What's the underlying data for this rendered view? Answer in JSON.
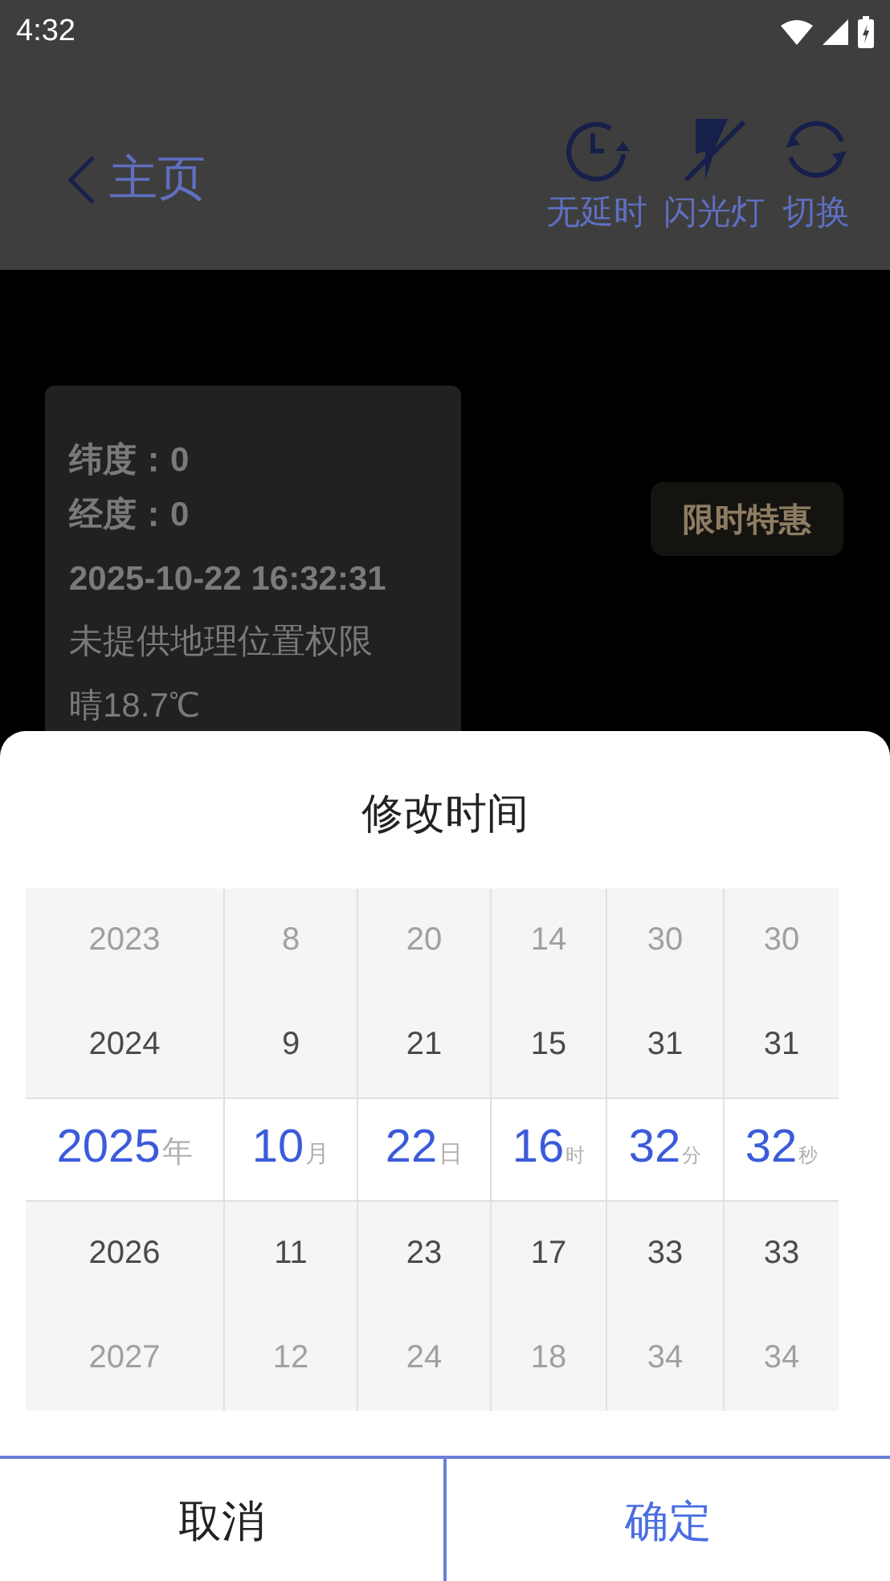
{
  "status_bar": {
    "time": "4:32"
  },
  "header": {
    "back_label": "主页",
    "actions": [
      {
        "kind": "timer",
        "label": "无延时"
      },
      {
        "kind": "flash-off",
        "label": "闪光灯"
      },
      {
        "kind": "switch",
        "label": "切换"
      }
    ]
  },
  "info_card": {
    "lines": [
      "纬度：0",
      "经度：0",
      "2025-10-22  16:32:31",
      "未提供地理位置权限",
      "晴18.7℃"
    ]
  },
  "promo_badge": "限时特惠",
  "dialog": {
    "title": "修改时间",
    "columns": [
      {
        "unit": "年",
        "items": [
          {
            "label": "2023",
            "selected": false
          },
          {
            "label": "2024",
            "selected": false
          },
          {
            "label": "2025",
            "selected": true
          },
          {
            "label": "2026",
            "selected": false
          },
          {
            "label": "2027",
            "selected": false
          }
        ]
      },
      {
        "unit": "月",
        "items": [
          {
            "label": "8",
            "selected": false
          },
          {
            "label": "9",
            "selected": false
          },
          {
            "label": "10",
            "selected": true
          },
          {
            "label": "11",
            "selected": false
          },
          {
            "label": "12",
            "selected": false
          }
        ]
      },
      {
        "unit": "日",
        "items": [
          {
            "label": "20",
            "selected": false
          },
          {
            "label": "21",
            "selected": false
          },
          {
            "label": "22",
            "selected": true
          },
          {
            "label": "23",
            "selected": false
          },
          {
            "label": "24",
            "selected": false
          }
        ]
      },
      {
        "unit": "时",
        "items": [
          {
            "label": "14",
            "selected": false
          },
          {
            "label": "15",
            "selected": false
          },
          {
            "label": "16",
            "selected": true
          },
          {
            "label": "17",
            "selected": false
          },
          {
            "label": "18",
            "selected": false
          }
        ]
      },
      {
        "unit": "分",
        "items": [
          {
            "label": "30",
            "selected": false
          },
          {
            "label": "31",
            "selected": false
          },
          {
            "label": "32",
            "selected": true
          },
          {
            "label": "33",
            "selected": false
          },
          {
            "label": "34",
            "selected": false
          }
        ]
      },
      {
        "unit": "秒",
        "items": [
          {
            "label": "30",
            "selected": false
          },
          {
            "label": "31",
            "selected": false
          },
          {
            "label": "32",
            "selected": true
          },
          {
            "label": "33",
            "selected": false
          },
          {
            "label": "34",
            "selected": false
          }
        ]
      }
    ],
    "cancel": "取消",
    "confirm": "确定"
  }
}
